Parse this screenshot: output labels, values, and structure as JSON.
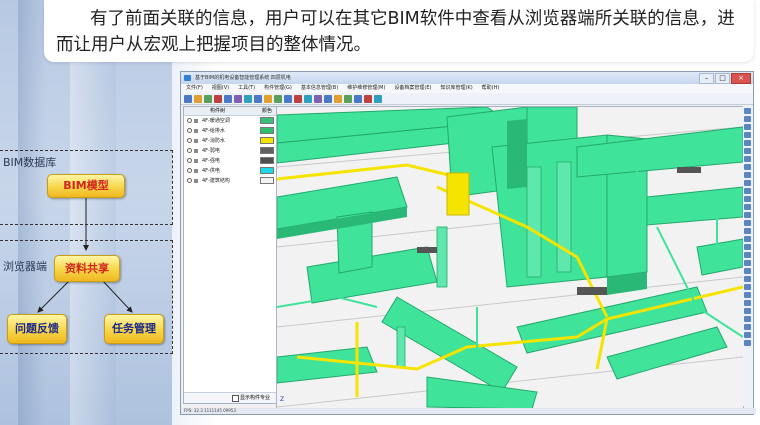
{
  "caption": "有了前面关联的信息，用户可以在其它BIM软件中查看从浏览器端所关联的信息，进而让用户从宏观上把握项目的整体情况。",
  "diagram": {
    "zone_db_label": "BIM数据库",
    "zone_browser_label": "浏览器端",
    "node_bim_model": "BIM模型",
    "node_shared": "资料共享",
    "node_feedback": "问题反馈",
    "node_task": "任务管理"
  },
  "app": {
    "title": "基于BIM的机电设备智能管理系统 四层机电",
    "menu": [
      "文件(F)",
      "视图(V)",
      "工具(T)",
      "构件管理(G)",
      "基本信息管理(B)",
      "维护维修管理(M)",
      "设备档案管理(E)",
      "知识库管理(K)",
      "帮助(H)"
    ],
    "panel_headers": {
      "name": "构件树",
      "color": "颜色"
    },
    "layers": [
      {
        "name": "4F-暖通空调",
        "color": "#3dbf7a"
      },
      {
        "name": "4F-给排水",
        "color": "#2fbf6a"
      },
      {
        "name": "4F-消防水",
        "color": "#f5e400"
      },
      {
        "name": "4F-弱电",
        "color": "#606060"
      },
      {
        "name": "4F-强电",
        "color": "#505050"
      },
      {
        "name": "4F-供电",
        "color": "#19d9e6"
      },
      {
        "name": "4F-建筑结构",
        "color": "#f2f2f2"
      }
    ],
    "footer_checkbox_label": "显示构件专业",
    "status_text": "FPS: 32.3 1111145 09953",
    "axis_label": "Z"
  },
  "colors": {
    "pipe_green": "#3fe39a",
    "pipe_green_dark": "#2ab877",
    "pipe_yellow": "#f5e400",
    "viewport_bg": "#f2f2f2"
  }
}
